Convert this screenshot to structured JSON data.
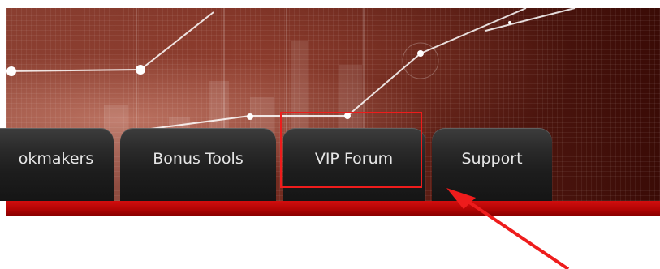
{
  "nav": {
    "tabs": [
      {
        "label": "okmakers"
      },
      {
        "label": "Bonus Tools"
      },
      {
        "label": "VIP Forum"
      },
      {
        "label": "Support"
      }
    ]
  },
  "annotation": {
    "highlighted_tab": "VIP Forum",
    "color": "#ee1c1c"
  },
  "colors": {
    "banner_dark": "#3a0b06",
    "tab_bar": "#c10a0a",
    "tab_text": "#e6e6e6"
  }
}
